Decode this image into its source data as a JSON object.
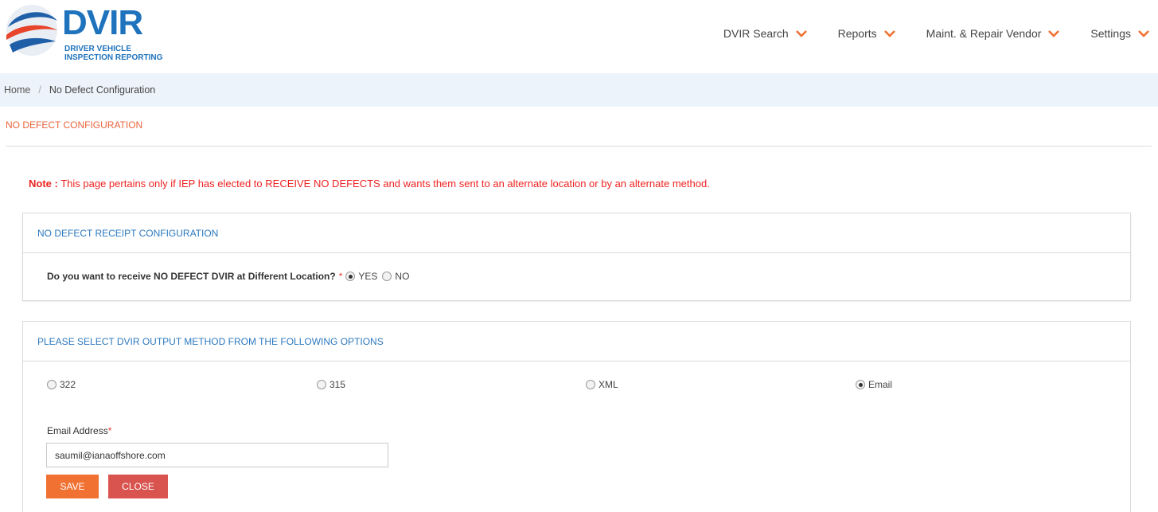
{
  "logo": {
    "title": "DVIR",
    "subtitle_line1": "DRIVER VEHICLE",
    "subtitle_line2": "INSPECTION REPORTING"
  },
  "nav": {
    "items": [
      {
        "label": "DVIR Search"
      },
      {
        "label": "Reports"
      },
      {
        "label": "Maint. & Repair Vendor"
      },
      {
        "label": "Settings"
      }
    ]
  },
  "breadcrumb": {
    "home": "Home",
    "separator": "/",
    "current": "No Defect Configuration"
  },
  "page": {
    "title": "NO DEFECT CONFIGURATION",
    "note_label": "Note :",
    "note_text": "This page pertains only if IEP has elected to RECEIVE NO DEFECTS and wants them sent to an alternate location or by an alternate method."
  },
  "receipt_panel": {
    "heading": "NO DEFECT RECEIPT CONFIGURATION",
    "question": "Do you want to receive NO DEFECT DVIR at Different Location?",
    "required_mark": "*",
    "options": [
      {
        "label": "YES",
        "checked": true
      },
      {
        "label": "NO",
        "checked": false
      }
    ]
  },
  "output_panel": {
    "heading": "PLEASE SELECT DVIR OUTPUT METHOD FROM THE FOLLOWING OPTIONS",
    "options": [
      {
        "label": "322",
        "checked": false
      },
      {
        "label": "315",
        "checked": false
      },
      {
        "label": "XML",
        "checked": false
      },
      {
        "label": "Email",
        "checked": true
      }
    ],
    "email_label": "Email Address",
    "email_required_mark": "*",
    "email_value": "saumil@ianaoffshore.com",
    "save_label": "SAVE",
    "close_label": "CLOSE"
  },
  "colors": {
    "brand_blue": "#1f73bd",
    "accent_orange": "#f07132",
    "close_red": "#d9534f",
    "note_red": "#ee2222",
    "panel_heading_blue": "#2d79bf",
    "breadcrumb_bg": "#edf3fa"
  }
}
